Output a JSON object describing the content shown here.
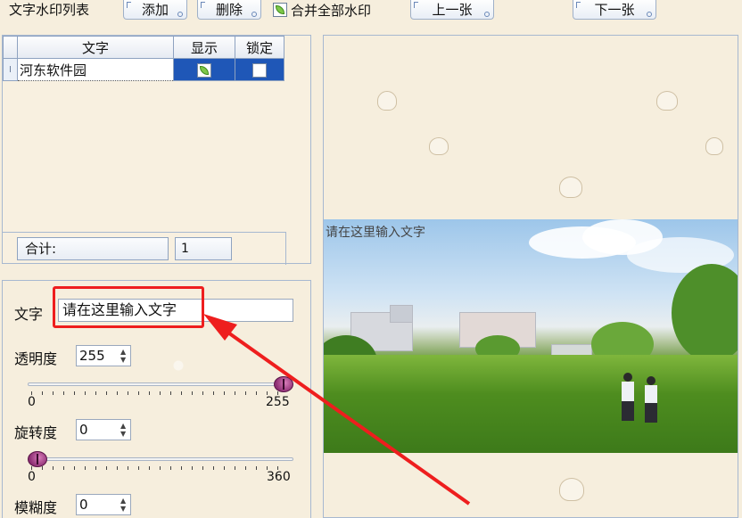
{
  "toolbar": {
    "title": "文字水印列表",
    "add_label": "添加",
    "delete_label": "删除",
    "merge_label": "合并全部水印",
    "prev_label": "上一张",
    "next_label": "下一张"
  },
  "list": {
    "columns": [
      "文字",
      "显示",
      "锁定"
    ],
    "rows": [
      {
        "text": "河东软件园",
        "show": true,
        "locked": false
      }
    ],
    "total_label": "合计:",
    "total_value": "1"
  },
  "settings": {
    "text_label": "文字",
    "text_value": "请在这里输入文字",
    "opacity_label": "透明度",
    "opacity_value": "255",
    "opacity_min": "0",
    "opacity_max": "255",
    "opacity_level": 1.0,
    "rotation_label": "旋转度",
    "rotation_value": "0",
    "rotation_min": "0",
    "rotation_max": "360",
    "rotation_level": 0.0,
    "blur_label": "模糊度",
    "blur_value": "0"
  },
  "preview": {
    "watermark_text": "请在这里输入文字"
  },
  "colors": {
    "highlight": "#ee1e1e",
    "selection": "#1f57b7",
    "panel_bg": "#f6eedd"
  },
  "icons": {
    "merge_checkbox": "leaf-check-icon",
    "slider_thumb": "ladybug-thumb-icon"
  }
}
